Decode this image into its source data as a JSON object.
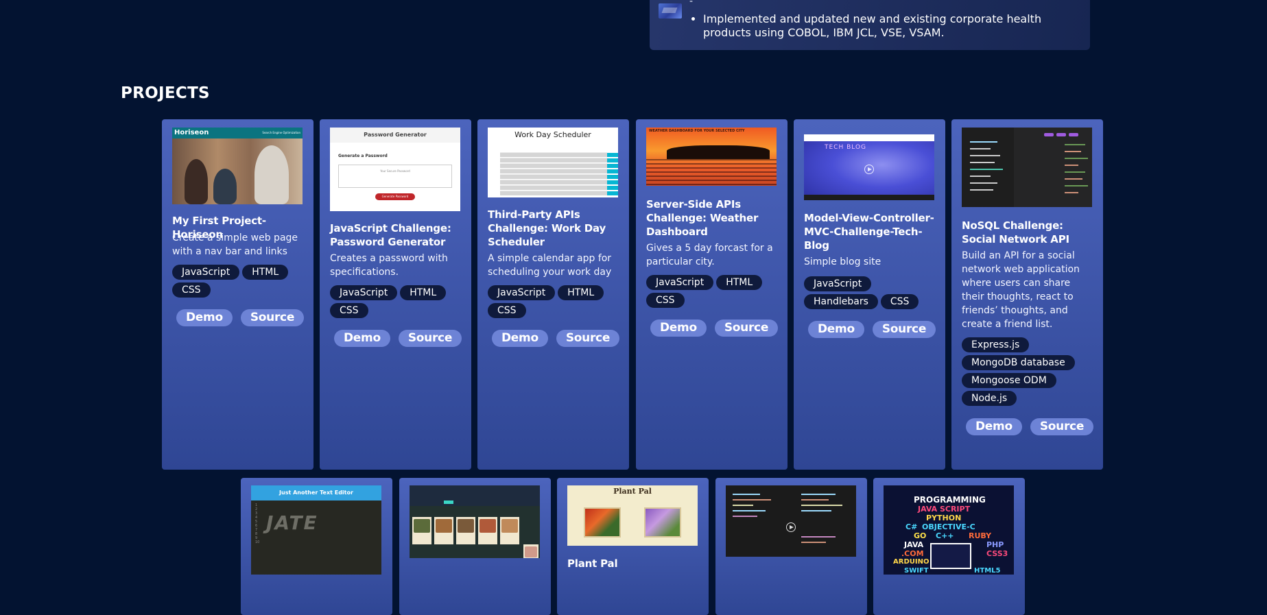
{
  "experience": {
    "dash": "-",
    "bullets": [
      "Implemented and updated new and existing corporate health products using COBOL, IBM JCL, VSE, VSAM."
    ]
  },
  "projects": {
    "heading": "PROJECTS",
    "cards": [
      {
        "title": "My First Project-Horiseon",
        "description": "Create a simple web page with a nav bar and links",
        "tags": [
          "JavaScript",
          "HTML",
          "CSS"
        ],
        "demo_label": "Demo",
        "source_label": "Source",
        "screenshot_text": "Horiseon",
        "screenshot_nav": "Search Engine Optimization"
      },
      {
        "title": "JavaScript Challenge: Password Generator",
        "description": "Creates a password with specifications.",
        "tags": [
          "JavaScript",
          "HTML",
          "CSS"
        ],
        "demo_label": "Demo",
        "source_label": "Source",
        "screenshot_text": "Password Generator",
        "screenshot_sub": "Generate a Password",
        "screenshot_placeholder": "Your Secure Password",
        "screenshot_button": "Generate Password"
      },
      {
        "title": "Third-Party APIs Challenge: Work Day Scheduler",
        "description": "A simple calendar app for scheduling your work day",
        "tags": [
          "JavaScript",
          "HTML",
          "CSS"
        ],
        "demo_label": "Demo",
        "source_label": "Source",
        "screenshot_text": "Work Day Scheduler"
      },
      {
        "title": "Server-Side APIs Challenge: Weather Dashboard",
        "description": "Gives a 5 day forcast for a particular city.",
        "tags": [
          "JavaScript",
          "HTML",
          "CSS"
        ],
        "demo_label": "Demo",
        "source_label": "Source",
        "screenshot_text": "WEATHER DASHBOARD FOR YOUR SELECTED CITY"
      },
      {
        "title": "Model-View-Controller-MVC-Challenge-Tech-Blog",
        "description": "Simple blog site",
        "tags": [
          "JavaScript",
          "Handlebars",
          "CSS"
        ],
        "demo_label": "Demo",
        "source_label": "Source",
        "screenshot_text": "TECH BLOG"
      },
      {
        "title": "NoSQL Challenge: Social Network API",
        "description": "Build an API for a social network web application where users can share their thoughts, react to friends’ thoughts, and create a friend list.",
        "tags": [
          "Express.js",
          "MongoDB database",
          "Mongoose ODM",
          "Node.js"
        ],
        "demo_label": "Demo",
        "source_label": "Source"
      },
      {
        "title": "",
        "screenshot_text": "Just Another Text Editor",
        "screenshot_logo": "JATE"
      },
      {
        "title": ""
      },
      {
        "title": "Plant Pal",
        "screenshot_text": "Plant Pal"
      },
      {
        "title": ""
      },
      {
        "title": "",
        "screenshot_words": [
          "PROGRAMMING",
          "JAVA SCRIPT",
          "PYTHON",
          "C#",
          "OBJECTIVE-C",
          "GO",
          "C++",
          "RUBY",
          "JAVA",
          "PHP",
          ".COM",
          "CSS3",
          "ARDUINO",
          "SWIFT",
          "HTML5"
        ]
      }
    ]
  },
  "colors": {
    "page_background": "#031331",
    "card_gradient_top": "#4c64bd",
    "card_gradient_bottom": "#2f4694",
    "tag_background": "#0f1a3c",
    "button_background": "#6d83d6"
  }
}
